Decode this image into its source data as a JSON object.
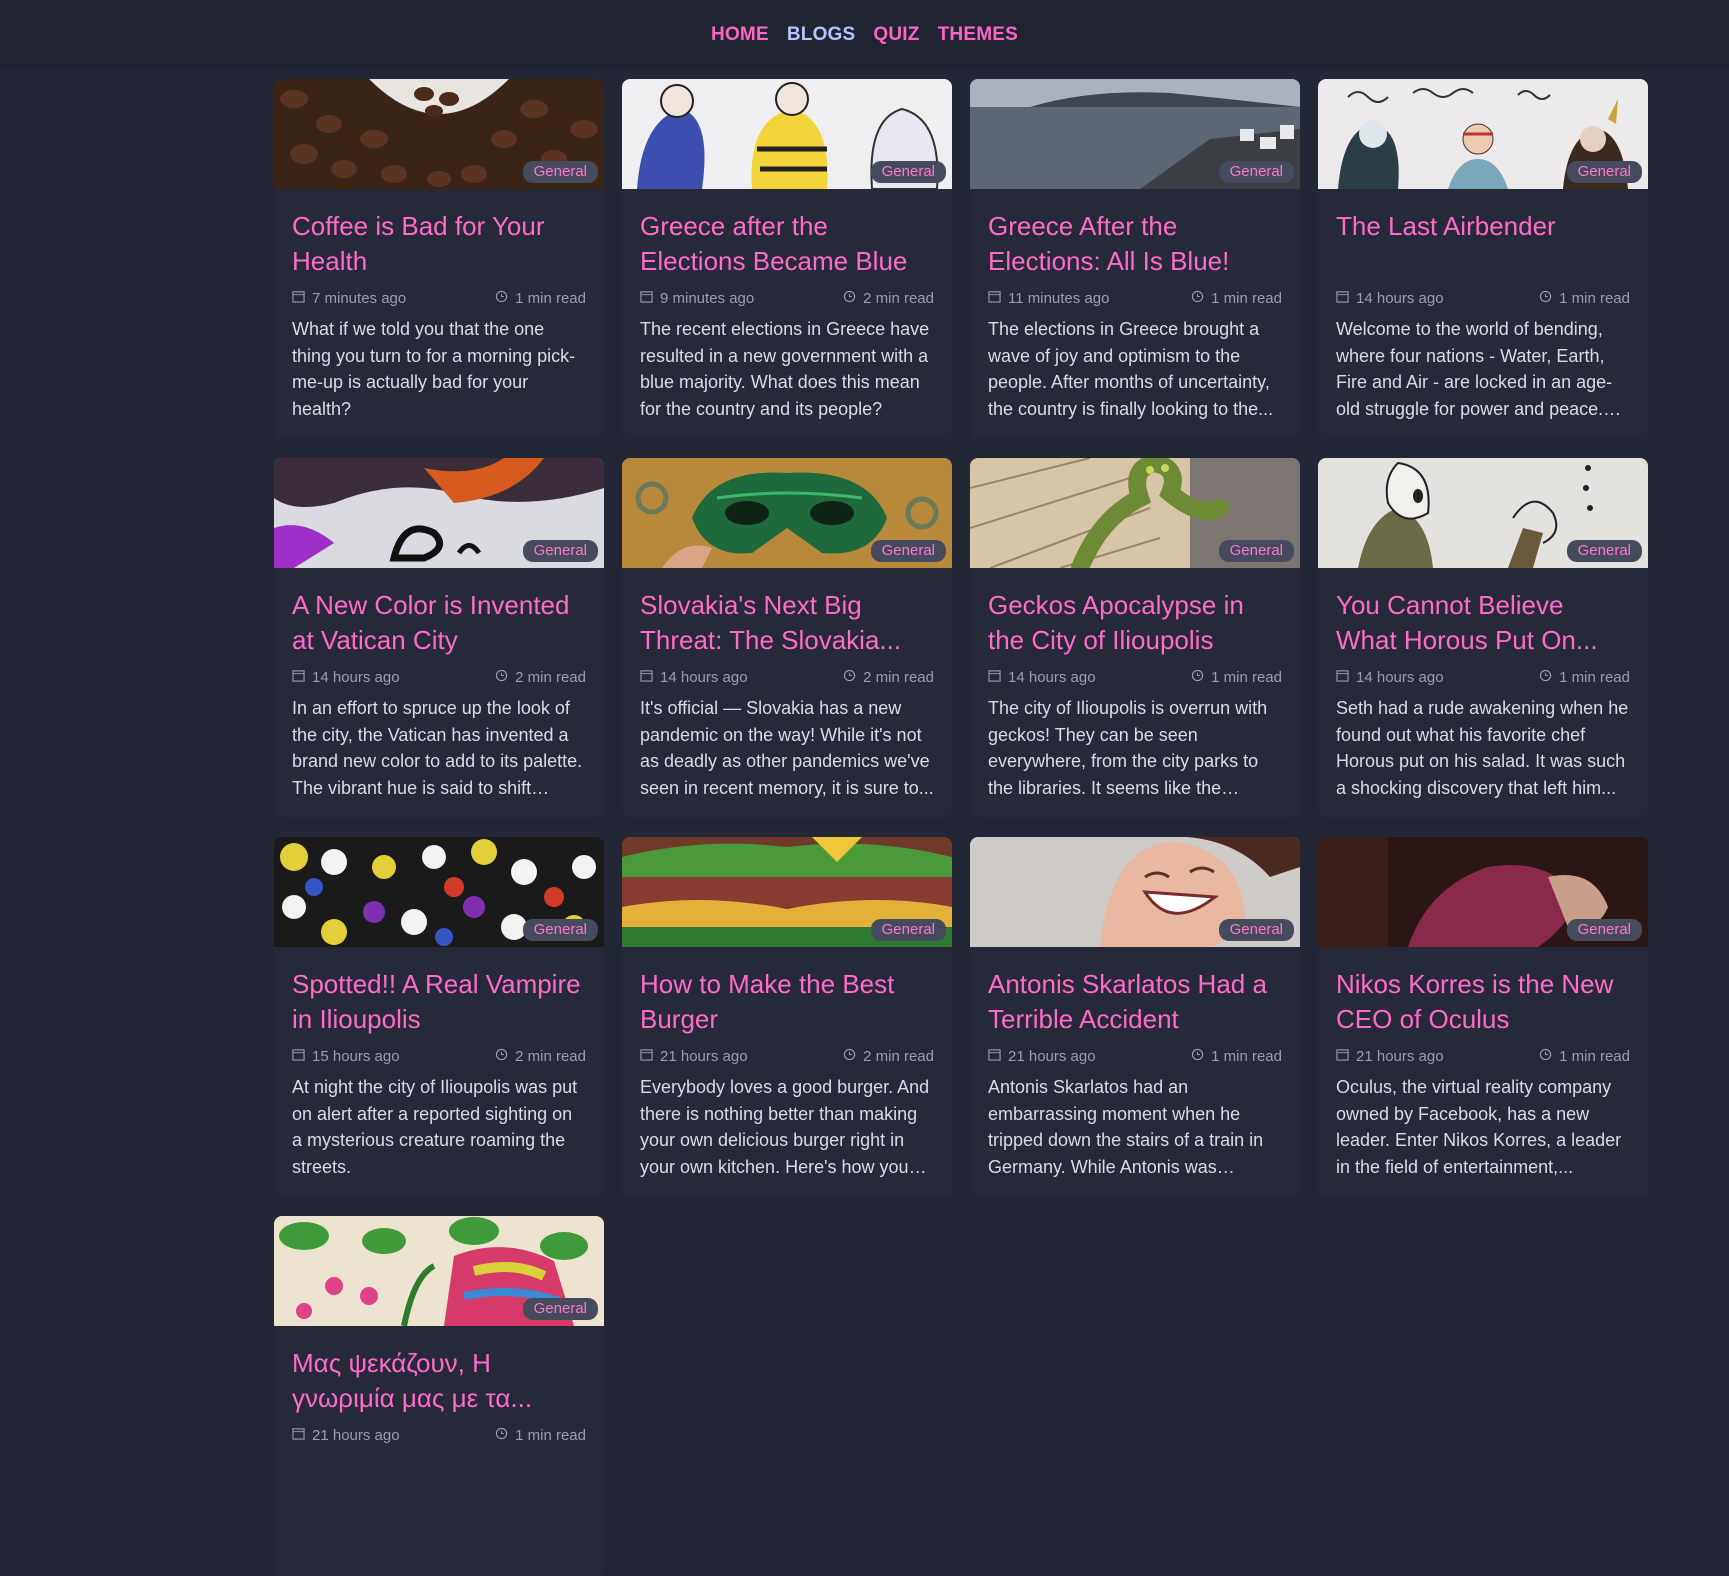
{
  "nav": {
    "home": "HOME",
    "blogs": "BLOGS",
    "quiz": "QUIZ",
    "themes": "THEMES"
  },
  "colors": {
    "accent": "#ff6bcb",
    "nav_active": "#b6c4ff",
    "background": "#232634",
    "card": "#262937"
  },
  "cards": [
    {
      "badge": "General",
      "title": "Coffee is Bad for Your Health",
      "date": "7 minutes ago",
      "read": "1 min read",
      "excerpt": "What if we told you that the one thing you turn to for a morning pick-me-up is actually bad for your health?"
    },
    {
      "badge": "General",
      "title": "Greece after the Elections Became Blue",
      "date": "9 minutes ago",
      "read": "2 min read",
      "excerpt": "The recent elections in Greece have resulted in a new government with a blue majority. What does this mean for the country and its people?"
    },
    {
      "badge": "General",
      "title": "Greece After the Elections: All Is Blue!",
      "date": "11 minutes ago",
      "read": "1 min read",
      "excerpt": "The elections in Greece brought a wave of joy and optimism to the people. After months of uncertainty, the country is finally looking to the..."
    },
    {
      "badge": "General",
      "title": "The Last Airbender",
      "date": "14 hours ago",
      "read": "1 min read",
      "excerpt": "Welcome to the world of bending, where four nations - Water, Earth, Fire and Air - are locked in an age-old struggle for power and peace. Enter..."
    },
    {
      "badge": "General",
      "title": "A New Color is Invented at Vatican City",
      "date": "14 hours ago",
      "read": "2 min read",
      "excerpt": "In an effort to spruce up the look of the city, the Vatican has invented a brand new color to add to its palette. The vibrant hue is said to shift from..."
    },
    {
      "badge": "General",
      "title": "Slovakia's Next Big Threat: The Slovakia...",
      "date": "14 hours ago",
      "read": "2 min read",
      "excerpt": "It's official — Slovakia has a new pandemic on the way! While it's not as deadly as other pandemics we've seen in recent memory, it is sure to..."
    },
    {
      "badge": "General",
      "title": "Geckos Apocalypse in the City of Ilioupolis",
      "date": "14 hours ago",
      "read": "1 min read",
      "excerpt": "The city of Ilioupolis is overrun with geckos! They can be seen everywhere, from the city parks to the libraries. It seems like the geckos ar..."
    },
    {
      "badge": "General",
      "title": "You Cannot Believe What Horous Put On...",
      "date": "14 hours ago",
      "read": "1 min read",
      "excerpt": "Seth had a rude awakening when he found out what his favorite chef Horous put on his salad. It was such a shocking discovery that left him..."
    },
    {
      "badge": "General",
      "title": "Spotted!! A Real Vampire in Ilioupolis",
      "date": "15 hours ago",
      "read": "2 min read",
      "excerpt": "At night the city of Ilioupolis was put on alert after a reported sighting on a mysterious creature roaming the streets."
    },
    {
      "badge": "General",
      "title": "How to Make the Best Burger",
      "date": "21 hours ago",
      "read": "2 min read",
      "excerpt": "Everybody loves a good burger. And there is nothing better than making your own delicious burger right in your own kitchen. Here's how you c..."
    },
    {
      "badge": "General",
      "title": "Antonis Skarlatos Had a Terrible Accident",
      "date": "21 hours ago",
      "read": "1 min read",
      "excerpt": "Antonis Skarlatos had an embarrassing moment when he tripped down the stairs of a train in Germany. While Antonis was luckily..."
    },
    {
      "badge": "General",
      "title": "Nikos Korres is the New CEO of Oculus",
      "date": "21 hours ago",
      "read": "1 min read",
      "excerpt": "Oculus, the virtual reality company owned by Facebook, has a new leader. Enter Nikos Korres, a leader in the field of entertainment,..."
    },
    {
      "badge": "General",
      "title": "Μας ψεκάζουν, Η γνωριμία μας με τα...",
      "date": "21 hours ago",
      "read": "1 min read",
      "excerpt": ""
    }
  ]
}
